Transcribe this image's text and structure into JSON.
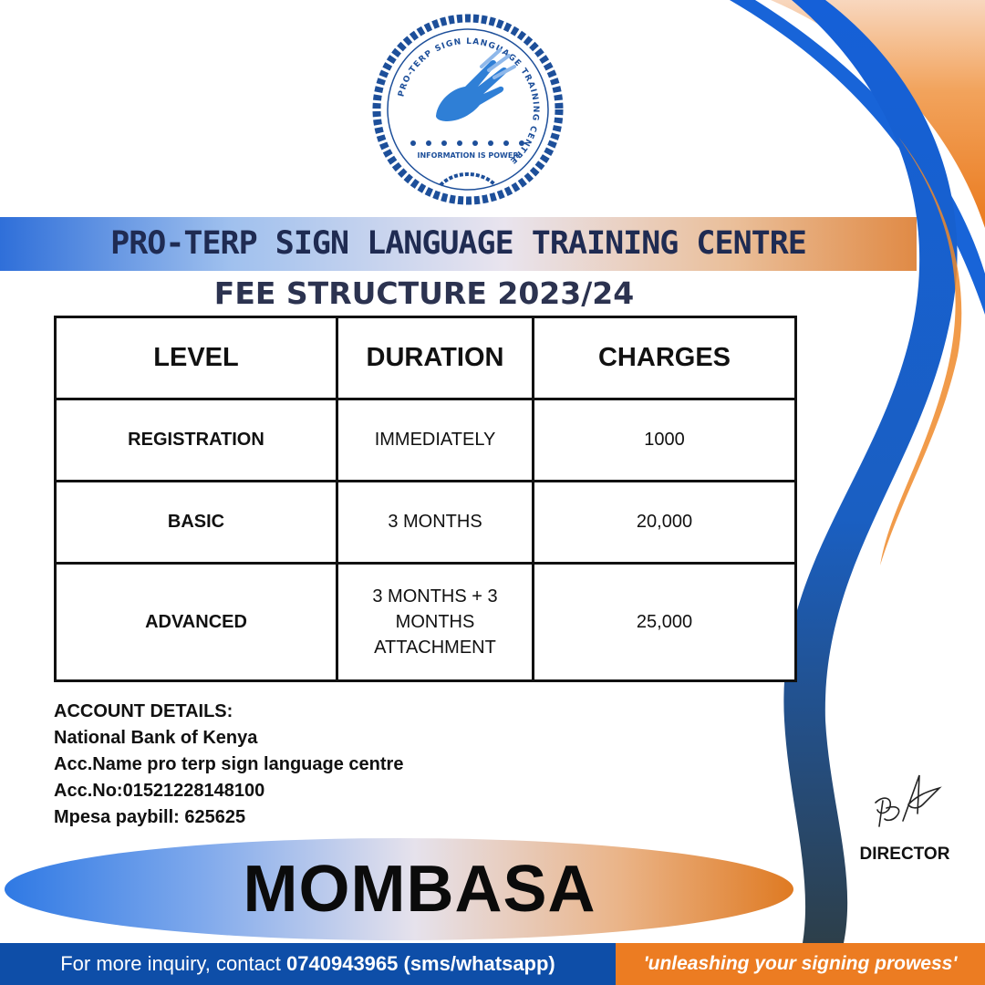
{
  "logo": {
    "ring_text": "PRO-TERP SIGN LANGUAGE TRAINING CENTRE",
    "motto": "INFORMATION IS POWER"
  },
  "header": {
    "title": "PRO-TERP SIGN LANGUAGE TRAINING CENTRE",
    "subtitle": "FEE STRUCTURE  2023/24"
  },
  "table": {
    "columns": [
      "LEVEL",
      "DURATION",
      "CHARGES"
    ],
    "rows": [
      {
        "level": "REGISTRATION",
        "duration": "IMMEDIATELY",
        "charges": "1000"
      },
      {
        "level": "BASIC",
        "duration": "3 MONTHS",
        "charges": "20,000"
      },
      {
        "level": "ADVANCED",
        "duration": "3 MONTHS + 3 MONTHS ATTACHMENT",
        "charges": "25,000"
      }
    ]
  },
  "account": {
    "heading": "ACCOUNT DETAILS:",
    "bank": "National Bank of Kenya",
    "acc_name": "Acc.Name pro terp sign language centre",
    "acc_no": "Acc.No:01521228148100",
    "paybill": "Mpesa paybill: 625625"
  },
  "director_label": "DIRECTOR",
  "city": "MOMBASA",
  "footer": {
    "contact_prefix": "For more inquiry, contact ",
    "contact_number": "0740943965 (sms/whatsapp)",
    "tagline": "'unleashing your signing prowess'"
  },
  "colors": {
    "primary_blue": "#0e4ea8",
    "accent_orange": "#ec7c22",
    "title_navy": "#1f2b52"
  }
}
